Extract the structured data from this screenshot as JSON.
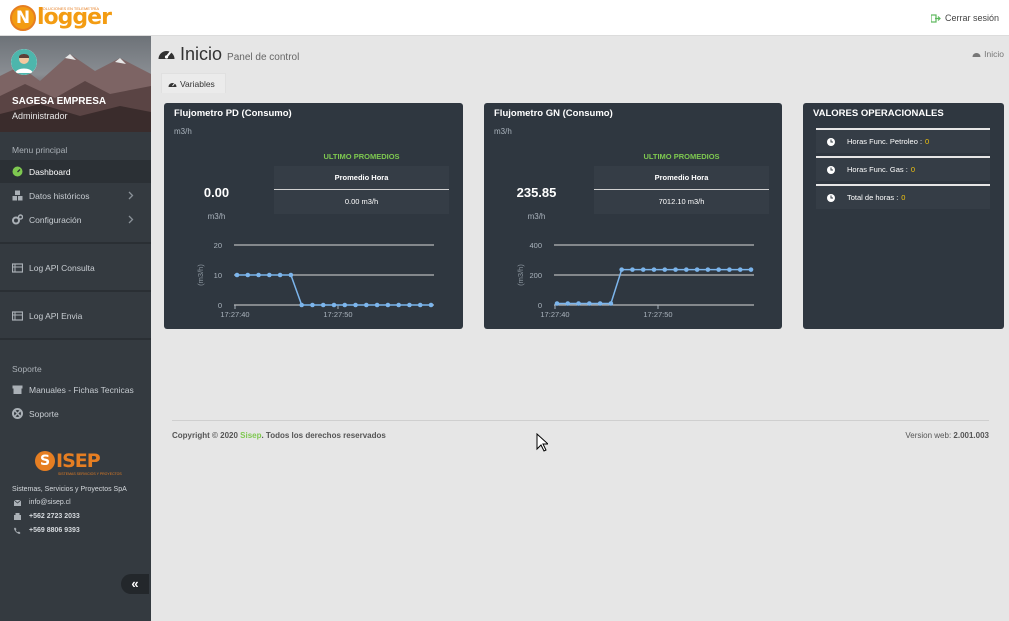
{
  "header": {
    "brand": "logger",
    "brand_initial": "N",
    "brand_tagline": "SOLUCIONES EN TELEMETRÍA",
    "logout_label": "Cerrar sesión"
  },
  "sidebar": {
    "user_name": "SAGESA EMPRESA",
    "user_role": "Administrador",
    "menu_heading": "Menu principal",
    "items": [
      {
        "label": "Dashboard",
        "icon": "dashboard-icon",
        "active": true
      },
      {
        "label": "Datos históricos",
        "icon": "cubes-icon"
      },
      {
        "label": "Configuración",
        "icon": "gears-icon"
      },
      {
        "label": "Log API Consulta",
        "icon": "server-icon"
      },
      {
        "label": "Log API Envia",
        "icon": "server-icon"
      }
    ],
    "support_heading": "Soporte",
    "support_items": [
      {
        "label": "Manuales - Fichas Tecnicas",
        "icon": "archive-icon"
      },
      {
        "label": "Soporte",
        "icon": "lifebuoy-icon"
      }
    ],
    "sisep_brand": "ISEP",
    "sisep_initial": "S",
    "sisep_tagline": "SISTEMAS SERVICIOS Y PROYECTOS",
    "company": "Sistemas, Servicios y Proyectos SpA",
    "email": "info@sisep.cl",
    "phone1": "+562 2723 2033",
    "phone2": "+569 8806 9393",
    "collapse_label": "«"
  },
  "page": {
    "title": "Inicio",
    "subtitle": "Panel de control",
    "breadcrumb": "Inicio",
    "tab_label": "Variables"
  },
  "cards": [
    {
      "title": "Flujometro PD (Consumo)",
      "unit": "m3/h",
      "ultimo_label": "ULTIMO PROMEDIOS",
      "prom_header": "Promedio Hora",
      "prom_value": "0.00 m3/h",
      "big_value": "0.00",
      "big_unit": "m3/h"
    },
    {
      "title": "Flujometro GN (Consumo)",
      "unit": "m3/h",
      "ultimo_label": "ULTIMO PROMEDIOS",
      "prom_header": "Promedio Hora",
      "prom_value": "7012.10 m3/h",
      "big_value": "235.85",
      "big_unit": "m3/h"
    }
  ],
  "ops": {
    "title": "VALORES OPERACIONALES",
    "rows": [
      {
        "label": "Horas Func. Petroleo :",
        "value": "0"
      },
      {
        "label": "Horas Func. Gas :",
        "value": "0"
      },
      {
        "label": "Total de horas :",
        "value": "0"
      }
    ]
  },
  "footer": {
    "copyright_prefix": "Copyright © 2020 ",
    "copyright_brand": "Sisep",
    "copyright_suffix": ". Todos los derechos reservados",
    "version_label": "Version web: ",
    "version_value": "2.001.003"
  },
  "colors": {
    "sidebar": "#343a40",
    "card": "#2f3740",
    "accent_green": "#7ec850",
    "accent_orange": "#f39c12",
    "series_line": "#7cb5ec",
    "value_yellow": "#f1c40f"
  },
  "chart_data": [
    {
      "type": "line",
      "ylabel": "(m3/h)",
      "ylim": [
        0,
        20
      ],
      "yticks": [
        "0",
        "10",
        "20"
      ],
      "x_ticks": [
        "17:27:40",
        "17:27:50"
      ],
      "series": [
        {
          "values": [
            10,
            10,
            10,
            10,
            10,
            10,
            0,
            0,
            0,
            0,
            0,
            0,
            0,
            0,
            0,
            0,
            0,
            0,
            0
          ]
        }
      ]
    },
    {
      "type": "line",
      "ylabel": "(m3/h)",
      "ylim": [
        0,
        400
      ],
      "yticks": [
        "0",
        "200",
        "400"
      ],
      "x_ticks": [
        "17:27:40",
        "17:27:50"
      ],
      "series": [
        {
          "values": [
            10,
            10,
            10,
            10,
            10,
            10,
            235.85,
            235.85,
            235.85,
            235.85,
            235.85,
            235.85,
            235.85,
            235.85,
            235.85,
            235.85,
            235.85,
            235.85,
            235.85
          ]
        }
      ]
    }
  ]
}
